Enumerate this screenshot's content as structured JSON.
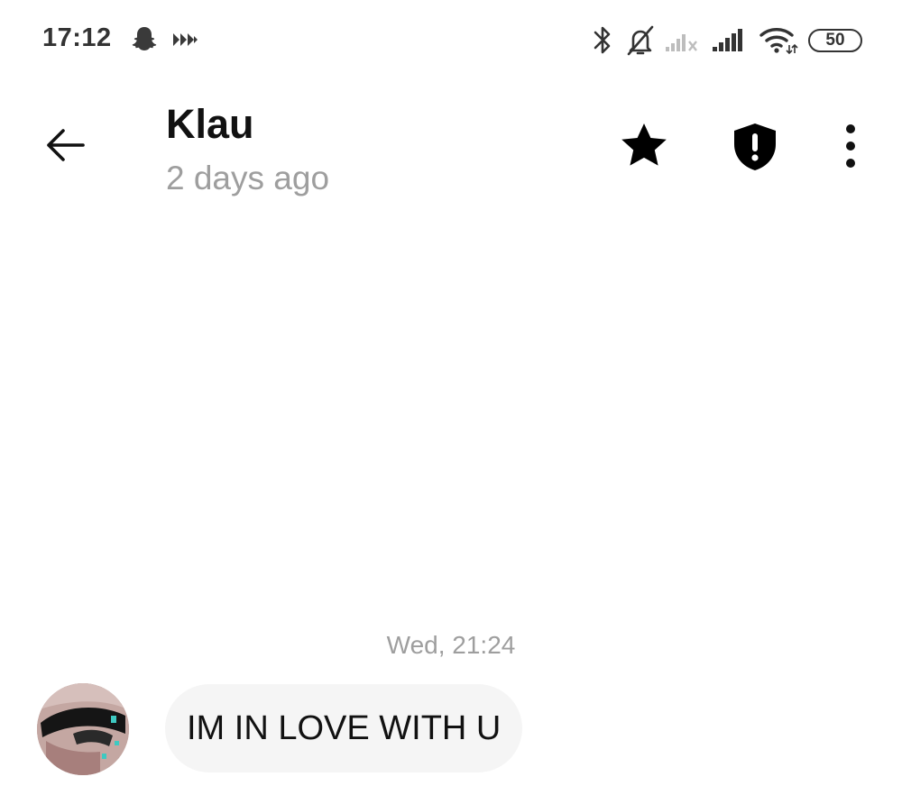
{
  "status_bar": {
    "time": "17:12",
    "battery": "50",
    "icons": [
      "snapchat-ghost-icon",
      "media-forward-icon",
      "bluetooth-icon",
      "bell-muted-icon",
      "signal-weak-icon",
      "signal-strong-icon",
      "wifi-icon",
      "battery-icon"
    ]
  },
  "header": {
    "contact_name": "Klau",
    "last_seen": "2 days ago",
    "actions": [
      "back-arrow-icon",
      "star-icon",
      "shield-alert-icon",
      "more-vertical-icon"
    ]
  },
  "conversation": {
    "timestamp": "Wed, 21:24",
    "messages": [
      {
        "text": "IM IN LOVE WITH U",
        "incoming": true
      }
    ]
  },
  "colors": {
    "background": "#ffffff",
    "text": "#111111",
    "muted": "#9e9e9e",
    "bubble": "#f5f5f5"
  }
}
